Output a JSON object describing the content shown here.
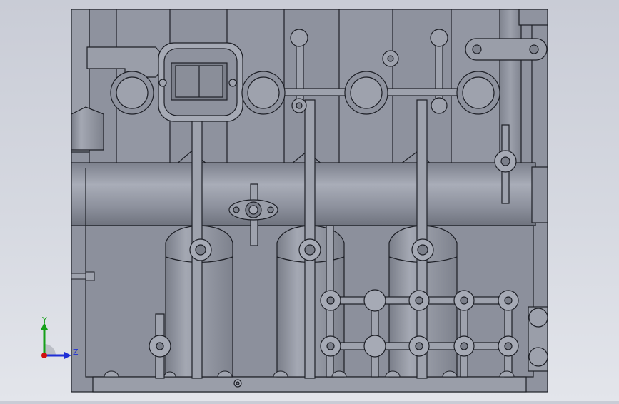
{
  "viewport": {
    "model": "engine-block-front-view",
    "colors": {
      "background_top": "#c9ccd6",
      "background_bottom": "#e3e5eb",
      "part_fill": "#8f939f",
      "part_light": "#a5a9b4",
      "part_dark": "#777b87",
      "edge": "#1d1f26"
    }
  },
  "triad": {
    "y_label": "Y",
    "z_label": "Z",
    "y_color": "#16a01a",
    "z_color": "#1f2fd6",
    "origin_color": "#d01010"
  }
}
